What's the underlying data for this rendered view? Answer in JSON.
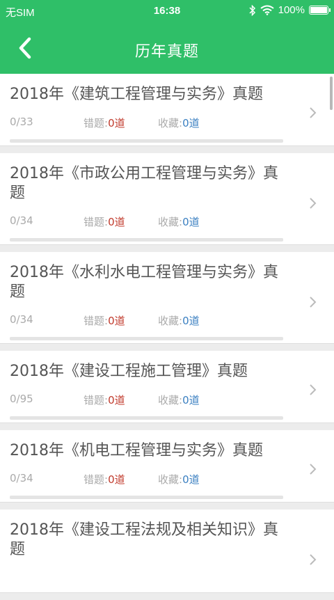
{
  "status_bar": {
    "carrier": "无SIM",
    "time": "16:38",
    "battery": "100%",
    "battery_level": 1.0
  },
  "nav": {
    "title": "历年真题"
  },
  "items": [
    {
      "title": "2018年《建筑工程管理与实务》真题",
      "count": "0/33",
      "wrong_label": "错题:",
      "wrong_value": "0道",
      "fav_label": "收藏:",
      "fav_value": "0道",
      "progress": 0
    },
    {
      "title": "2018年《市政公用工程管理与实务》真题",
      "count": "0/34",
      "wrong_label": "错题:",
      "wrong_value": "0道",
      "fav_label": "收藏:",
      "fav_value": "0道",
      "progress": 0
    },
    {
      "title": "2018年《水利水电工程管理与实务》真题",
      "count": "0/34",
      "wrong_label": "错题:",
      "wrong_value": "0道",
      "fav_label": "收藏:",
      "fav_value": "0道",
      "progress": 0
    },
    {
      "title": "2018年《建设工程施工管理》真题",
      "count": "0/95",
      "wrong_label": "错题:",
      "wrong_value": "0道",
      "fav_label": "收藏:",
      "fav_value": "0道",
      "progress": 0
    },
    {
      "title": "2018年《机电工程管理与实务》真题",
      "count": "0/34",
      "wrong_label": "错题:",
      "wrong_value": "0道",
      "fav_label": "收藏:",
      "fav_value": "0道",
      "progress": 0
    },
    {
      "title": "2018年《建设工程法规及相关知识》真题"
    }
  ],
  "colors": {
    "accent": "#2fbf68",
    "wrong": "#c0392b",
    "fav": "#3a7fc1"
  },
  "icons": {
    "back": "chevron-left-icon",
    "row_arrow": "chevron-right-icon",
    "bluetooth": "bluetooth-icon",
    "wifi": "wifi-icon",
    "battery": "battery-icon"
  }
}
